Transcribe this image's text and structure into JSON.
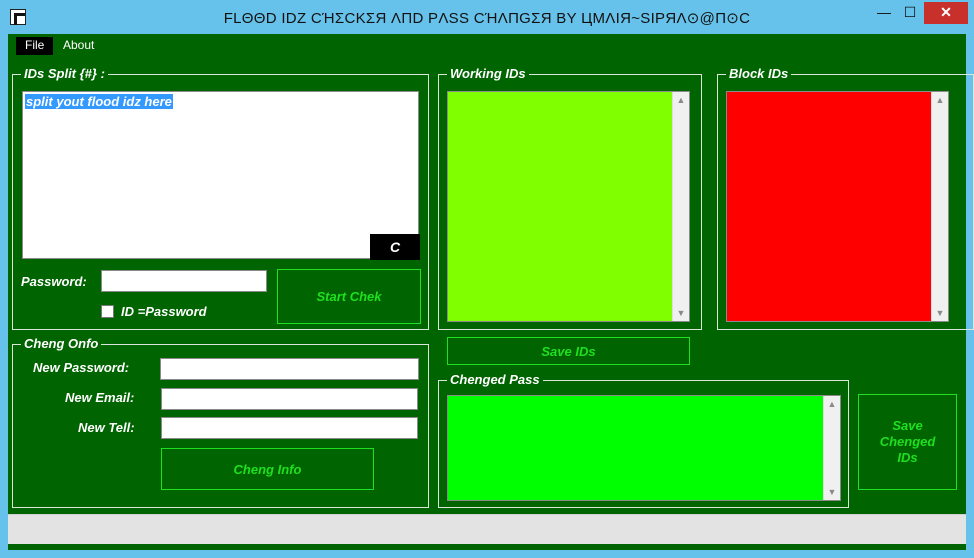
{
  "window": {
    "title": "FLΘΘD IDZ CΉΣCKΣЯ ΛПD PΛSS CΉΛПGΣЯ BY ЦMΛIЯ~SIPЯΛ⊙@П⊙C",
    "controls": {
      "minimize": "—",
      "maximize": "☐",
      "close": "✕"
    }
  },
  "menu": {
    "file": "File",
    "about": "About"
  },
  "split_group": {
    "legend": "IDs Split {#} :",
    "textarea_value": "split yout flood idz here",
    "clear_button": "C",
    "password_label": "Password:",
    "password_value": "",
    "checkbox_label": "ID =Password",
    "checkbox_checked": false,
    "start_button": "Start Chek"
  },
  "working_group": {
    "legend": "Working IDs",
    "color": "#80ff00"
  },
  "block_group": {
    "legend": "Block IDs",
    "color": "#ff0000"
  },
  "save_ids_button": "Save IDs",
  "cheng_group": {
    "legend": "Cheng Onfo",
    "new_password_label": "New Password:",
    "new_email_label": "New Email:",
    "new_tell_label": "New Tell:",
    "new_password_value": "",
    "new_email_value": "",
    "new_tell_value": "",
    "cheng_button": "Cheng Info"
  },
  "changed_group": {
    "legend": "Chenged Pass",
    "color": "#00ff00"
  },
  "save_changed_button": "Save Chenged IDs",
  "colors": {
    "background": "#006400",
    "button_text": "#1fe01f"
  }
}
